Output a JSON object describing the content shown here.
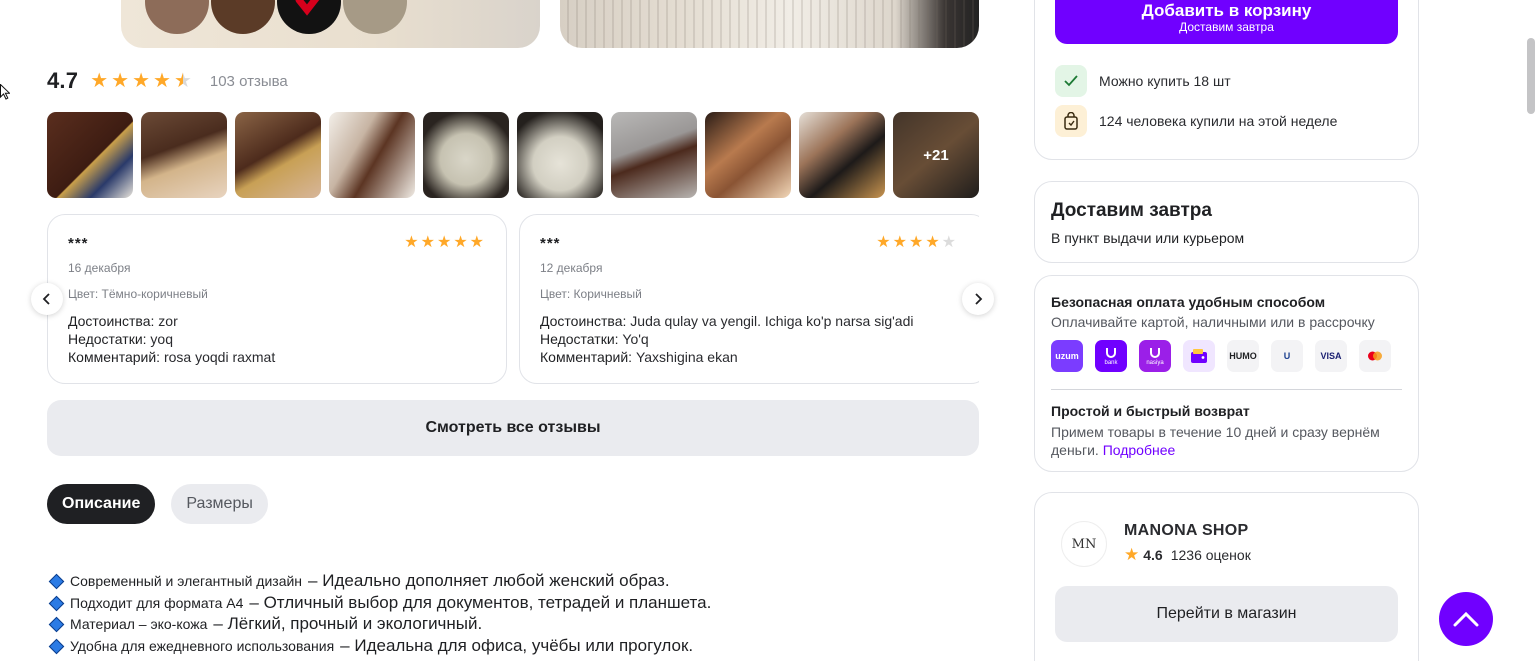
{
  "colors": {
    "accent": "#7000ff",
    "star": "#ffa828",
    "muted": "#8a8d94"
  },
  "rating": {
    "value": "4.7",
    "stars": 4.5,
    "reviews_count": "103 отзыва"
  },
  "gallery": {
    "more_label": "+21"
  },
  "reviews": [
    {
      "author": "***",
      "stars": 5,
      "date": "16 декабря",
      "color": "Цвет: Тёмно-коричневый",
      "pros_label": "Достоинства:",
      "pros": "zor",
      "cons_label": "Недостатки:",
      "cons": "yoq",
      "comment_label": "Комментарий:",
      "comment": "rosa yoqdi raxmat"
    },
    {
      "author": "***",
      "stars": 4,
      "date": "12 декабря",
      "color": "Цвет: Коричневый",
      "pros_label": "Достоинства:",
      "pros": "Juda qulay va yengil. Ichiga ko'p narsa sig'adi",
      "cons_label": "Недостатки:",
      "cons": "Yo'q",
      "comment_label": "Комментарий:",
      "comment": "Yaxshigina ekan"
    }
  ],
  "all_reviews_button": "Смотреть все отзывы",
  "tabs": [
    {
      "label": "Описание",
      "active": true
    },
    {
      "label": "Размеры",
      "active": false
    }
  ],
  "description": [
    {
      "small": "Современный и элегантный дизайн",
      "big": "– Идеально дополняет любой женский образ."
    },
    {
      "small": "Подходит для формата А4",
      "big": "– Отличный выбор для документов, тетрадей и планшета."
    },
    {
      "small": "Материал – эко-кожа",
      "big": "– Лёгкий, прочный и экологичный."
    },
    {
      "small": "Удобна для ежедневного использования",
      "big": "– Идеальна для офиса, учёбы или прогулок."
    }
  ],
  "buy": {
    "button_main": "Добавить в корзину",
    "button_sub": "Доставим завтра",
    "can_buy": "Можно купить 18 шт",
    "bought_week": "124 человека купили на этой неделе"
  },
  "delivery": {
    "title": "Доставим завтра",
    "subtitle": "В пункт выдачи или курьером"
  },
  "payment": {
    "title": "Безопасная оплата удобным способом",
    "subtitle": "Оплачивайте картой, наличными или в рассрочку",
    "methods": [
      {
        "name": "uzum-card-icon",
        "label": "uzum",
        "bg": "#7b3cff",
        "fg": "#ffffff"
      },
      {
        "name": "uzum-bank-icon",
        "label": "bank",
        "bg": "#7000ff",
        "fg": "#ffffff"
      },
      {
        "name": "uzum-nasiya-icon",
        "label": "nasiya",
        "bg": "#9b1fe8",
        "fg": "#ffffff"
      },
      {
        "name": "wallet-icon",
        "label": "",
        "bg": "#f0e6ff",
        "fg": "#7000ff"
      },
      {
        "name": "humo-icon",
        "label": "HUMO",
        "bg": "#f3f3f5",
        "fg": "#1f2023"
      },
      {
        "name": "uzcard-icon",
        "label": "U",
        "bg": "#f3f3f5",
        "fg": "#1b3f8f"
      },
      {
        "name": "visa-icon",
        "label": "VISA",
        "bg": "#f3f3f5",
        "fg": "#1a1f71"
      },
      {
        "name": "mastercard-icon",
        "label": "",
        "bg": "#f3f3f5",
        "fg": "#eb001b"
      }
    ],
    "return_title": "Простой и быстрый возврат",
    "return_text": "Примем товары в течение 10 дней и сразу вернём деньги.",
    "return_link": "Подробнее"
  },
  "shop": {
    "logo_text": "MN",
    "name": "MANONA SHOP",
    "rating": "4.6",
    "reviews": "1236 оценок",
    "button": "Перейти в магазин"
  }
}
